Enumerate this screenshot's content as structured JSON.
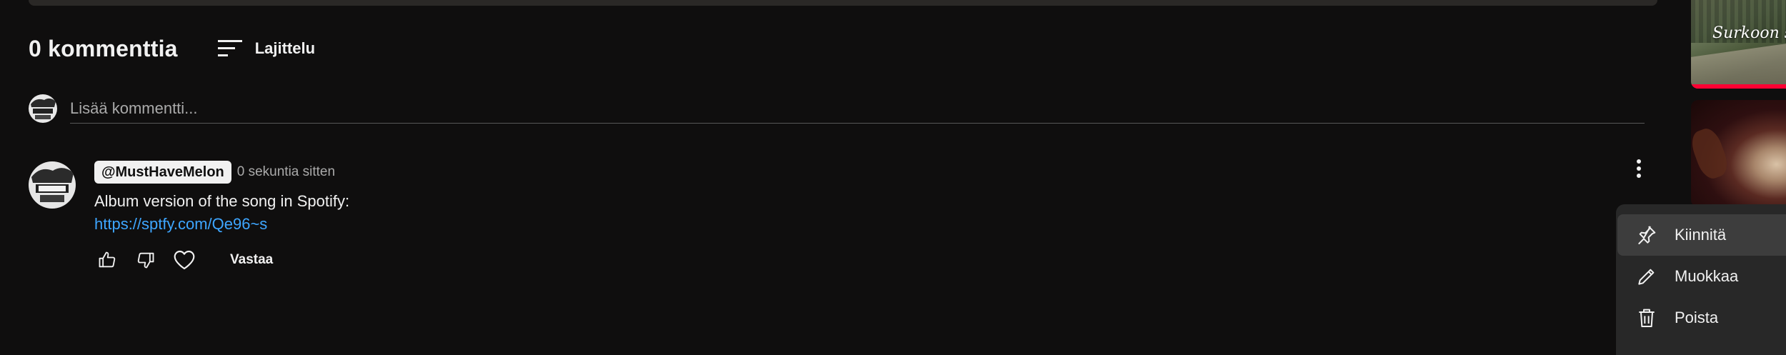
{
  "comments_section": {
    "count_label": "0 kommenttia",
    "sort_label": "Lajittelu",
    "add_comment_placeholder": "Lisää kommentti..."
  },
  "comment": {
    "author": "@MustHaveMelon",
    "timestamp": "0 sekuntia sitten",
    "text": "Album version of the song in Spotify:",
    "link": "https://sptfy.com/Qe96~s",
    "reply_label": "Vastaa",
    "icons": [
      "like-icon",
      "dislike-icon",
      "heart-icon",
      "kebab-menu-icon"
    ]
  },
  "context_menu": {
    "items": [
      {
        "label": "Kiinnitä",
        "icon": "pin-icon"
      },
      {
        "label": "Muokkaa",
        "icon": "pencil-icon"
      },
      {
        "label": "Poista",
        "icon": "trash-icon"
      }
    ],
    "highlighted_item": "Kiinnitä"
  },
  "sidebar": {
    "thumb_title": "Surkoon sı"
  },
  "colors": {
    "background": "#0f0e0e",
    "text": "#f1f1f1",
    "secondary_text": "#aaaaaa",
    "link": "#3ea6ff",
    "menu_bg": "#282828",
    "menu_highlight": "#3d3d3d",
    "progress_red": "#ff0033"
  }
}
